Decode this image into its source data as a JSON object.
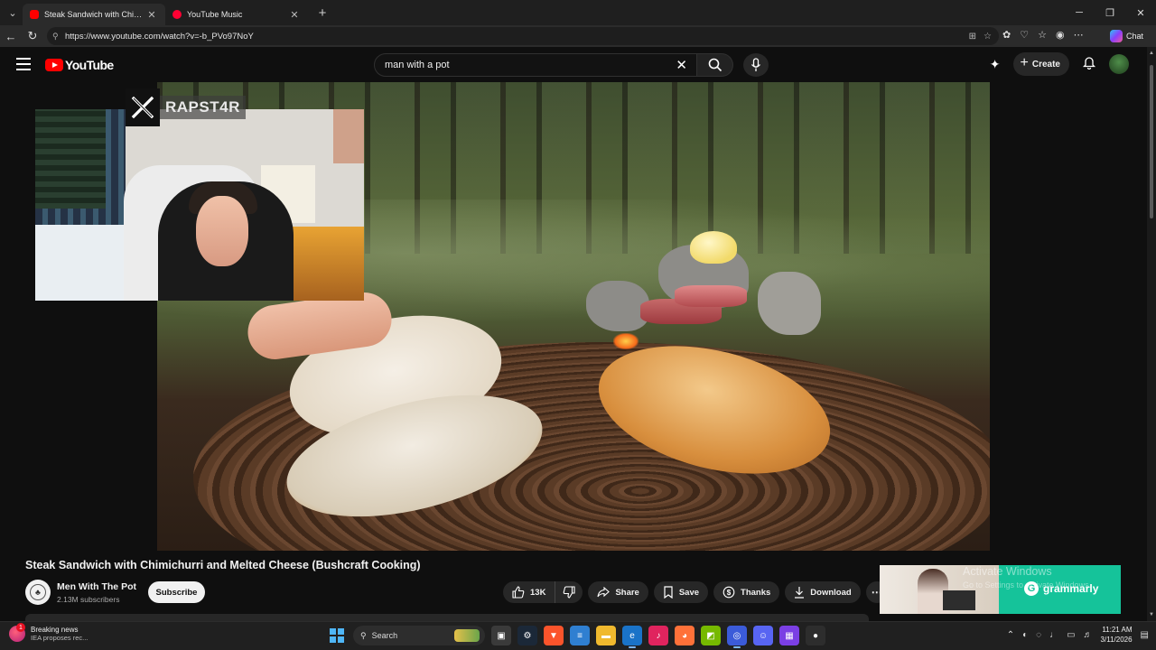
{
  "browser": {
    "tabs": [
      {
        "title": "Steak Sandwich with Chimichurri a",
        "active": true
      },
      {
        "title": "YouTube Music",
        "active": false
      }
    ],
    "url": "https://www.youtube.com/watch?v=-b_PVo97NoY",
    "chat_label": "Chat"
  },
  "youtube": {
    "logo_text": "YouTube",
    "search_query": "man with a pot",
    "create_label": "Create"
  },
  "overlay": {
    "handle": "RAPST4R"
  },
  "video": {
    "title": "Steak Sandwich with Chimichurri and Melted Cheese (Bushcraft Cooking)",
    "channel": "Men With The Pot",
    "subscribers": "2.13M subscribers",
    "subscribe_label": "Subscribe",
    "likes": "13K",
    "share_label": "Share",
    "save_label": "Save",
    "thanks_label": "Thanks",
    "download_label": "Download"
  },
  "ad": {
    "brand": "grammarly"
  },
  "watermark": {
    "title": "Activate Windows",
    "subtitle": "Go to Settings to activate Windows."
  },
  "taskbar": {
    "news_title": "Breaking news",
    "news_sub": "IEA proposes rec...",
    "news_badge": "1",
    "search_placeholder": "Search",
    "time": "11:21 AM",
    "date": "3/11/2026"
  },
  "colors": {
    "youtube_red": "#ff0000",
    "grammarly_green": "#15c39a",
    "background": "#0f0f0f"
  }
}
